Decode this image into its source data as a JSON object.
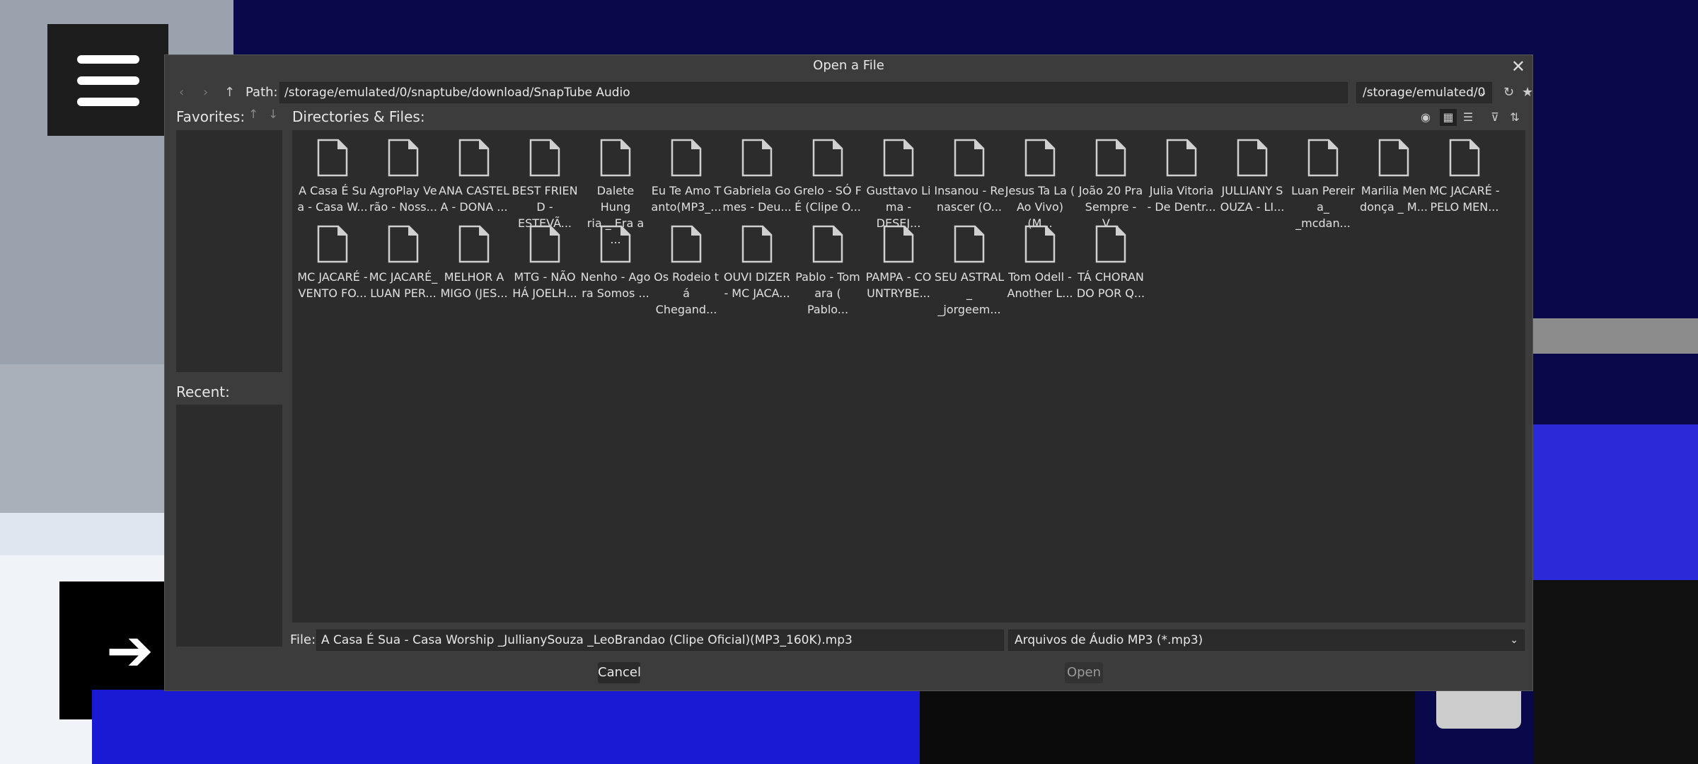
{
  "dialog": {
    "title": "Open a File",
    "path_label": "Path:",
    "path_value": "/storage/emulated/0/snaptube/download/SnapTube Audio",
    "drive": "/storage/emulated/0",
    "favorites_label": "Favorites:",
    "recent_label": "Recent:",
    "files_label": "Directories & Files:",
    "file_label": "File:",
    "file_value": "A Casa É Sua - Casa Worship _JullianySouza _LeoBrandao (Clipe Oficial)(MP3_160K).mp3",
    "filter": "Arquivos de Áudio MP3 (*.mp3)",
    "cancel": "Cancel",
    "open": "Open"
  },
  "files": [
    "A Casa É Su\na - Casa W...",
    "AgroPlay Ve\nrão - Noss...",
    "ANA CASTEL\nA - DONA ...",
    "BEST FRIEN\nD - ESTEVÃ...",
    "Dalete Hung\nria _ Era a ...",
    "Eu Te Amo T\nanto(MP3_...",
    "Gabriela Go\nmes - Deu...",
    "Grelo - SÓ F\nÉ (Clipe O...",
    "Gusttavo Li\nma - DESEJ...",
    "Insanou - Re\nnascer (O...",
    "Jesus Ta La (\nAo Vivo)(M...",
    "João 20   Pra\nSempre - V...",
    "Julia Vitoria\n- De Dentr...",
    "JULLIANY S\nOUZA - LI...",
    "Luan Pereir\na_ _mcdan...",
    "Marilia Men\ndonça _ M...",
    "MC JACARÉ -\nPELO MEN...",
    "MC JACARÉ -\nVENTO FO...",
    "MC JACARÉ_\nLUAN PER...",
    "MELHOR A\nMIGO (JES...",
    "MTG - NÃO\nHÁ JOELH...",
    "Nenho - Ago\nra Somos ...",
    "Os Rodeio t\ná Chegand...",
    "OUVI DIZER\n- MC JACA...",
    "Pablo - Tom\nara ( Pablo...",
    "PAMPA - CO\nUNTRYBE...",
    "SEU ASTRAL\n_ _jorgeem...",
    "Tom Odell -\nAnother L...",
    "TÁ CHORAN\nDO POR Q..."
  ]
}
